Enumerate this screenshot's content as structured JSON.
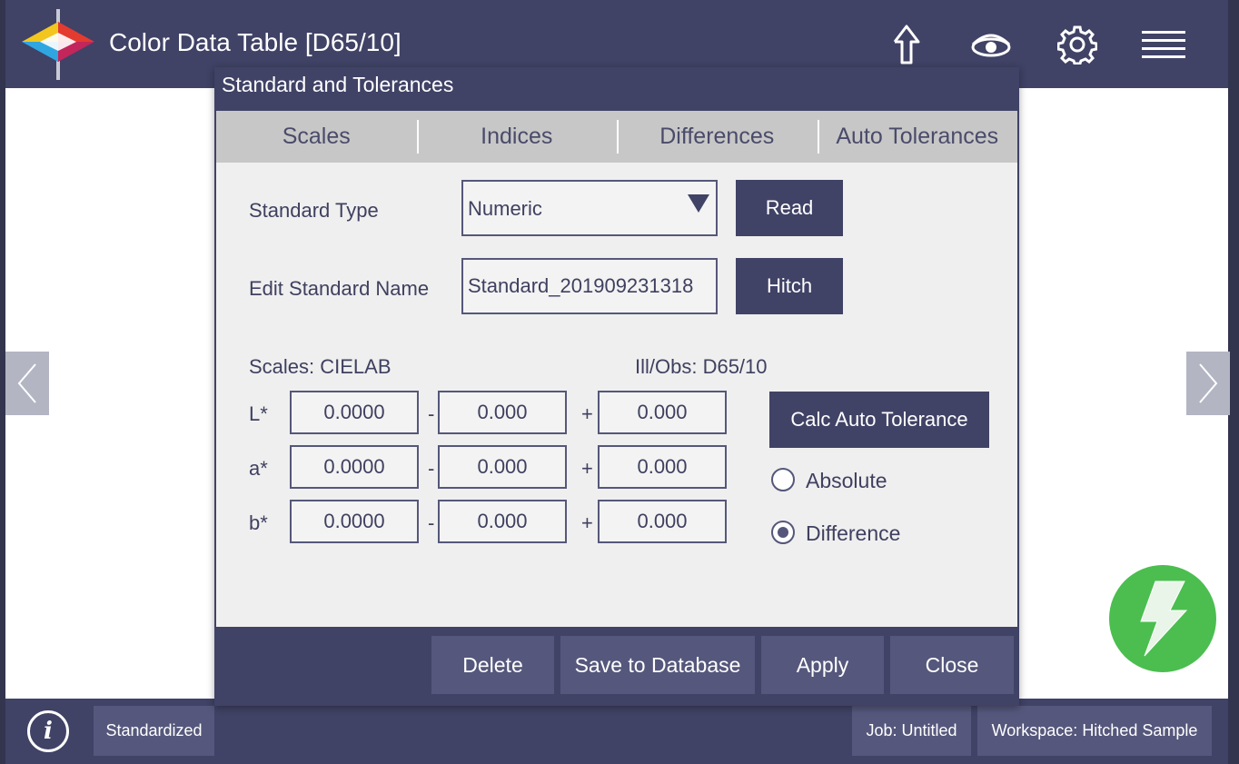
{
  "app": {
    "title": "Color Data Table [D65/10]"
  },
  "toolbar": {
    "icons": [
      "upload-arrow-icon",
      "eye-icon",
      "gear-icon",
      "hamburger-menu-icon"
    ]
  },
  "dialog": {
    "title": "Standard and Tolerances",
    "tabs": [
      {
        "label": "Scales"
      },
      {
        "label": "Indices"
      },
      {
        "label": "Differences"
      },
      {
        "label": "Auto Tolerances"
      }
    ],
    "standard_type_label": "Standard Type",
    "standard_type_value": "Numeric",
    "read_label": "Read",
    "edit_name_label": "Edit Standard Name",
    "edit_name_value": "Standard_201909231318",
    "hitch_label": "Hitch",
    "scales_text": "Scales:  CIELAB",
    "illobs_text": "Ill/Obs:  D65/10",
    "rows": [
      {
        "label": "L*",
        "value": "0.0000",
        "minus": "0.000",
        "plus": "0.000"
      },
      {
        "label": "a*",
        "value": "0.0000",
        "minus": "0.000",
        "plus": "0.000"
      },
      {
        "label": "b*",
        "value": "0.0000",
        "minus": "0.000",
        "plus": "0.000"
      }
    ],
    "minus_sign": "-",
    "plus_sign": "+",
    "calc_label": "Calc Auto Tolerance",
    "radio_absolute": "Absolute",
    "radio_difference": "Difference",
    "selected_radio": "Difference",
    "footer": {
      "delete": "Delete",
      "save": "Save to Database",
      "apply": "Apply",
      "close": "Close"
    }
  },
  "status": {
    "info_glyph": "i",
    "standardized": "Standardized",
    "job": "Job: Untitled",
    "workspace": "Workspace: Hitched Sample"
  },
  "colors": {
    "header": "#404266",
    "accent_button": "#404266",
    "fab": "#4bbe4f"
  }
}
